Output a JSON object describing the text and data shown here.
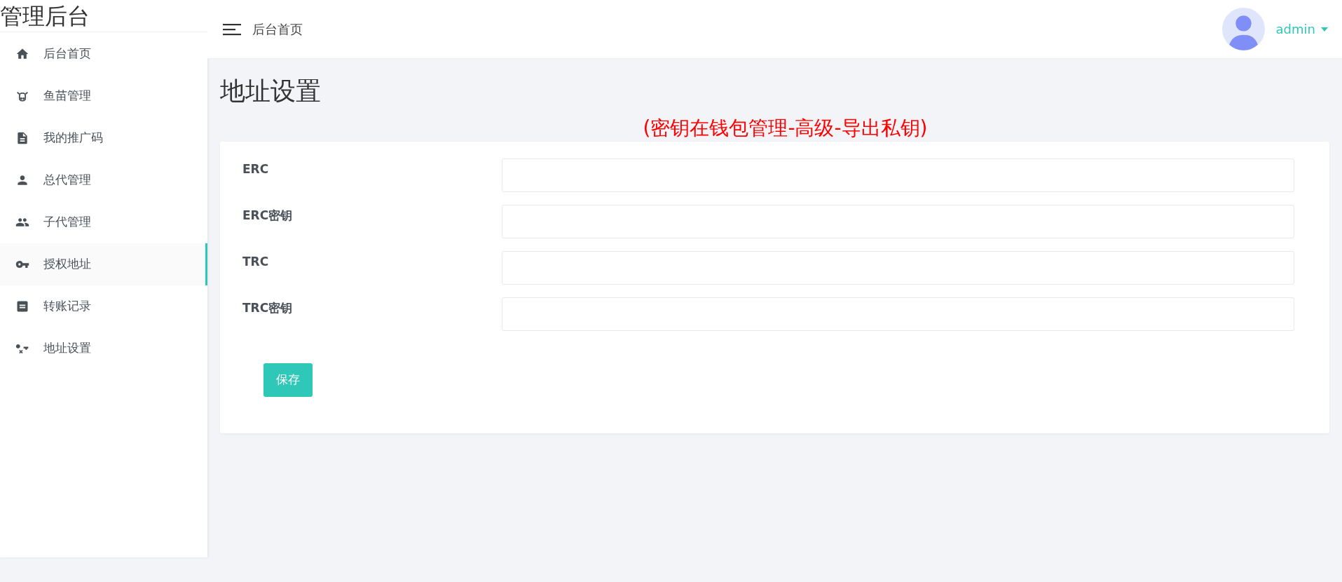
{
  "sidebar": {
    "title": "管理后台",
    "items": [
      {
        "label": "后台首页",
        "selected": false
      },
      {
        "label": "鱼苗管理",
        "selected": false
      },
      {
        "label": "我的推广码",
        "selected": false
      },
      {
        "label": "总代管理",
        "selected": false
      },
      {
        "label": "子代管理",
        "selected": false
      },
      {
        "label": "授权地址",
        "selected": true
      },
      {
        "label": "转账记录",
        "selected": false
      },
      {
        "label": "地址设置",
        "selected": false
      }
    ]
  },
  "header": {
    "breadcrumb": "后台首页",
    "user": "admin"
  },
  "page": {
    "title": "地址设置",
    "note": "(密钥在钱包管理-高级-导出私钥)",
    "fields": [
      {
        "label": "ERC"
      },
      {
        "label": "ERC密钥"
      },
      {
        "label": "TRC"
      },
      {
        "label": "TRC密钥"
      }
    ],
    "save_button": "保存"
  }
}
